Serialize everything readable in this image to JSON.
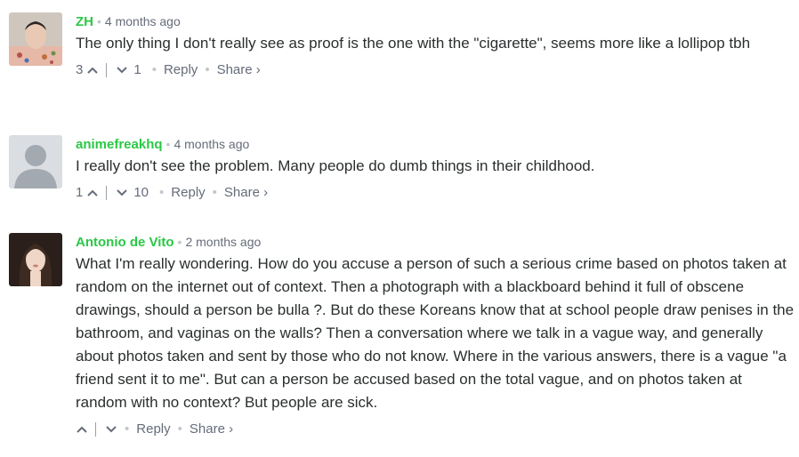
{
  "comments": [
    {
      "author": "ZH",
      "time": "4 months ago",
      "text": "The only thing I don't really see as proof is the one with the \"cigarette\", seems more like a lollipop tbh",
      "upvotes": "3",
      "downvotes": "1",
      "reply": "Reply",
      "share": "Share ›"
    },
    {
      "author": "animefreakhq",
      "time": "4 months ago",
      "text": "I really don't see the problem. Many people do dumb things in their childhood.",
      "upvotes": "1",
      "downvotes": "10",
      "reply": "Reply",
      "share": "Share ›"
    },
    {
      "author": "Antonio de Vito",
      "time": "2 months ago",
      "text": "What I'm really wondering. How do you accuse a person of such a serious crime based on photos taken at random on the internet out of context. Then a photograph with a blackboard behind it full of obscene drawings, should a person be bulla ?. But do these Koreans know that at school people draw penises in the bathroom, and vaginas on the walls? Then a conversation where we talk in a vague way, and generally about photos taken and sent by those who do not know. Where in the various answers, there is a vague \"a friend sent it to me\". But can a person be accused based on the total vague, and on photos taken at random with no context? But people are sick.",
      "upvotes": "",
      "downvotes": "",
      "reply": "Reply",
      "share": "Share ›"
    }
  ],
  "colors": {
    "author": "#2ac845",
    "meta": "#656c7a",
    "text": "#2a2e2e"
  }
}
